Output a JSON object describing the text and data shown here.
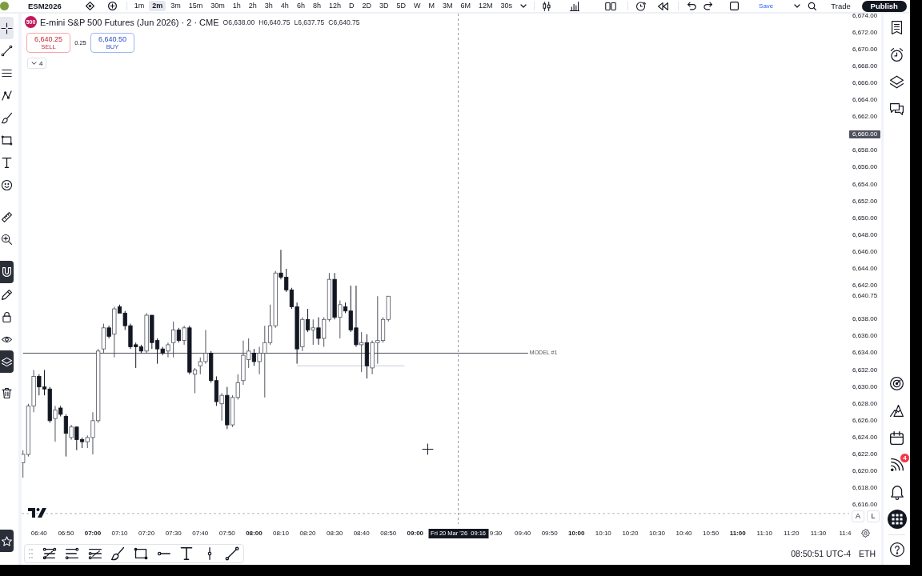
{
  "top_bar": {
    "symbol": "ESM2026",
    "timeframes": [
      {
        "label": "1m",
        "selected": false
      },
      {
        "label": "2m",
        "selected": true
      },
      {
        "label": "3m",
        "selected": false
      },
      {
        "label": "15m",
        "selected": false
      },
      {
        "label": "30m",
        "selected": false
      },
      {
        "label": "1h",
        "selected": false
      },
      {
        "label": "2h",
        "selected": false
      },
      {
        "label": "3h",
        "selected": false
      },
      {
        "label": "4h",
        "selected": false
      },
      {
        "label": "6h",
        "selected": false
      },
      {
        "label": "8h",
        "selected": false
      },
      {
        "label": "12h",
        "selected": false
      },
      {
        "label": "D",
        "selected": false
      },
      {
        "label": "2D",
        "selected": false
      },
      {
        "label": "3D",
        "selected": false
      },
      {
        "label": "5D",
        "selected": false
      },
      {
        "label": "W",
        "selected": false
      },
      {
        "label": "M",
        "selected": false
      },
      {
        "label": "3M",
        "selected": false
      },
      {
        "label": "6M",
        "selected": false
      },
      {
        "label": "12M",
        "selected": false
      },
      {
        "label": "30s",
        "selected": false
      }
    ],
    "save": "Save",
    "trade": "Trade",
    "publish": "Publish"
  },
  "left_toolbar": {
    "tools": [
      {
        "selected": true
      },
      {
        "selected": false
      },
      {
        "selected": false
      },
      {
        "selected": false
      },
      {
        "selected": false
      },
      {
        "selected": false
      },
      {
        "selected": false
      },
      {
        "selected": false
      },
      {
        "selected": false
      },
      {
        "selected": false
      }
    ],
    "toggles": [
      {
        "on": true
      },
      {
        "on": false
      },
      {
        "on": false
      },
      {
        "on": false
      },
      {
        "on": true
      }
    ],
    "favorites": {
      "on": true
    }
  },
  "chart": {
    "legend": {
      "logo_text": "500",
      "title": "E-mini S&P 500 Futures (Jun 2026) · 2 · CME",
      "ohlc": [
        "O6,638.00",
        "H6,640.75",
        "L6,637.75",
        "C6,640.75"
      ]
    },
    "sell": {
      "price": "6,640.25",
      "label": "SELL"
    },
    "spread": "0.25",
    "buy": {
      "price": "6,640.50",
      "label": "BUY"
    },
    "indicators_count": "4",
    "scale_buttons": [
      "A",
      "L"
    ],
    "chart_data": [
      {
        "type": "candlestick",
        "xlim": [
          "2026-03-20T06:33:30",
          "2026-03-20T11:41:30"
        ],
        "ylim": [
          6613.75,
          6674.25
        ],
        "x": [
          "2026-03-20T06:34",
          "2026-03-20T06:36",
          "2026-03-20T06:38",
          "2026-03-20T06:40",
          "2026-03-20T06:42",
          "2026-03-20T06:44",
          "2026-03-20T06:46",
          "2026-03-20T06:48",
          "2026-03-20T06:50",
          "2026-03-20T06:52",
          "2026-03-20T06:54",
          "2026-03-20T06:56",
          "2026-03-20T06:58",
          "2026-03-20T07:00",
          "2026-03-20T07:02",
          "2026-03-20T07:04",
          "2026-03-20T07:06",
          "2026-03-20T07:08",
          "2026-03-20T07:10",
          "2026-03-20T07:12",
          "2026-03-20T07:14",
          "2026-03-20T07:16",
          "2026-03-20T07:18",
          "2026-03-20T07:20",
          "2026-03-20T07:22",
          "2026-03-20T07:24",
          "2026-03-20T07:26",
          "2026-03-20T07:28",
          "2026-03-20T07:30",
          "2026-03-20T07:32",
          "2026-03-20T07:34",
          "2026-03-20T07:36",
          "2026-03-20T07:38",
          "2026-03-20T07:40",
          "2026-03-20T07:42",
          "2026-03-20T07:44",
          "2026-03-20T07:46",
          "2026-03-20T07:48",
          "2026-03-20T07:50",
          "2026-03-20T07:52",
          "2026-03-20T07:54",
          "2026-03-20T07:56",
          "2026-03-20T07:58",
          "2026-03-20T08:00",
          "2026-03-20T08:02",
          "2026-03-20T08:04",
          "2026-03-20T08:06",
          "2026-03-20T08:08",
          "2026-03-20T08:10",
          "2026-03-20T08:12",
          "2026-03-20T08:14",
          "2026-03-20T08:16",
          "2026-03-20T08:18",
          "2026-03-20T08:20",
          "2026-03-20T08:22",
          "2026-03-20T08:24",
          "2026-03-20T08:26",
          "2026-03-20T08:28",
          "2026-03-20T08:30",
          "2026-03-20T08:32",
          "2026-03-20T08:34",
          "2026-03-20T08:36",
          "2026-03-20T08:38",
          "2026-03-20T08:40",
          "2026-03-20T08:42",
          "2026-03-20T08:44",
          "2026-03-20T08:46",
          "2026-03-20T08:48",
          "2026-03-20T08:50"
        ],
        "ohlc": [
          [
            6621.0,
            6622.5,
            6619.25,
            6622.0
          ],
          [
            6622.0,
            6628.0,
            6621.75,
            6627.75
          ],
          [
            6627.75,
            6632.0,
            6627.0,
            6631.25
          ],
          [
            6631.25,
            6631.5,
            6629.0,
            6630.0
          ],
          [
            6630.0,
            6632.0,
            6629.0,
            6629.75
          ],
          [
            6629.75,
            6630.0,
            6625.75,
            6626.0
          ],
          [
            6626.25,
            6627.75,
            6623.5,
            6627.25
          ],
          [
            6627.5,
            6627.75,
            6626.5,
            6626.75
          ],
          [
            6626.5,
            6626.75,
            6621.75,
            6624.5
          ],
          [
            6624.0,
            6625.5,
            6623.75,
            6625.25
          ],
          [
            6625.25,
            6625.25,
            6622.5,
            6623.75
          ],
          [
            6623.75,
            6624.0,
            6622.75,
            6623.5
          ],
          [
            6623.5,
            6624.25,
            6622.75,
            6624.0
          ],
          [
            6624.0,
            6627.0,
            6622.0,
            6626.0
          ],
          [
            6626.0,
            6634.5,
            6625.75,
            6634.25
          ],
          [
            6634.5,
            6637.5,
            6634.0,
            6637.0
          ],
          [
            6637.0,
            6637.25,
            6635.75,
            6636.0
          ],
          [
            6636.25,
            6639.5,
            6633.5,
            6639.25
          ],
          [
            6639.5,
            6639.75,
            6638.75,
            6638.75
          ],
          [
            6638.75,
            6639.0,
            6636.75,
            6637.25
          ],
          [
            6637.25,
            6637.5,
            6634.5,
            6634.75
          ],
          [
            6635.0,
            6635.25,
            6632.25,
            6634.75
          ],
          [
            6634.75,
            6635.0,
            6634.0,
            6634.25
          ],
          [
            6634.25,
            6638.75,
            6634.0,
            6638.5
          ],
          [
            6638.5,
            6638.5,
            6634.5,
            6635.25
          ],
          [
            6635.5,
            6635.75,
            6632.75,
            6634.5
          ],
          [
            6634.5,
            6634.75,
            6633.75,
            6634.0
          ],
          [
            6634.25,
            6635.25,
            6633.5,
            6635.0
          ],
          [
            6635.25,
            6637.75,
            6633.5,
            6636.75
          ],
          [
            6636.75,
            6637.0,
            6635.25,
            6635.5
          ],
          [
            6635.5,
            6637.25,
            6635.0,
            6637.0
          ],
          [
            6637.0,
            6637.25,
            6631.5,
            6631.75
          ],
          [
            6631.5,
            6632.25,
            6629.25,
            6632.0
          ],
          [
            6632.5,
            6633.5,
            6631.5,
            6633.0
          ],
          [
            6633.0,
            6636.75,
            6632.75,
            6634.0
          ],
          [
            6634.0,
            6634.25,
            6630.5,
            6630.75
          ],
          [
            6630.75,
            6631.25,
            6627.75,
            6628.25
          ],
          [
            6628.0,
            6629.25,
            6626.0,
            6629.0
          ],
          [
            6629.0,
            6630.0,
            6625.0,
            6625.5
          ],
          [
            6625.5,
            6629.0,
            6625.25,
            6628.75
          ],
          [
            6628.75,
            6631.5,
            6628.5,
            6630.5
          ],
          [
            6630.75,
            6635.5,
            6630.25,
            6633.75
          ],
          [
            6633.25,
            6635.75,
            6632.25,
            6634.25
          ],
          [
            6634.0,
            6634.5,
            6632.5,
            6633.0
          ],
          [
            6633.0,
            6634.75,
            6631.5,
            6634.0
          ],
          [
            6634.0,
            6637.25,
            6628.75,
            6635.25
          ],
          [
            6635.25,
            6639.75,
            6635.0,
            6637.25
          ],
          [
            6637.25,
            6643.75,
            6637.0,
            6643.5
          ],
          [
            6643.5,
            6646.25,
            6642.75,
            6643.0
          ],
          [
            6643.0,
            6644.0,
            6641.25,
            6641.5
          ],
          [
            6641.5,
            6641.75,
            6639.25,
            6639.5
          ],
          [
            6639.5,
            6640.0,
            6632.75,
            6634.5
          ],
          [
            6634.75,
            6638.25,
            6634.25,
            6638.0
          ],
          [
            6638.0,
            6639.25,
            6636.5,
            6636.75
          ],
          [
            6636.75,
            6638.0,
            6635.0,
            6637.0
          ],
          [
            6637.0,
            6638.25,
            6635.0,
            6635.75
          ],
          [
            6635.75,
            6638.25,
            6634.75,
            6638.0
          ],
          [
            6638.0,
            6643.5,
            6637.75,
            6642.75
          ],
          [
            6642.75,
            6643.5,
            6638.0,
            6638.25
          ],
          [
            6638.25,
            6640.25,
            6635.75,
            6639.75
          ],
          [
            6639.5,
            6640.0,
            6638.75,
            6639.0
          ],
          [
            6639.0,
            6642.0,
            6636.5,
            6636.75
          ],
          [
            6637.0,
            6642.0,
            6634.75,
            6635.0
          ],
          [
            6635.0,
            6636.5,
            6631.75,
            6635.25
          ],
          [
            6635.25,
            6636.25,
            6631.0,
            6632.5
          ],
          [
            6632.25,
            6635.5,
            6631.5,
            6635.25
          ],
          [
            6635.25,
            6640.75,
            6632.75,
            6635.5
          ],
          [
            6635.5,
            6638.25,
            6635.25,
            6638.0
          ],
          [
            6638.0,
            6640.75,
            6637.75,
            6640.75
          ]
        ],
        "series": [
          {
            "name": "MODEL #1",
            "type": "line",
            "x": [
              "2026-03-20T06:34",
              "2026-03-20T09:42"
            ],
            "values": [
              6634,
              6634
            ],
            "color": "#50535e"
          },
          {
            "type": "line",
            "x": [
              "2026-03-20T08:16",
              "2026-03-20T08:56"
            ],
            "values": [
              6632.5,
              6632.5
            ],
            "color": "#c9ccd4"
          }
        ],
        "xticks": [
          {
            "value": "2026-03-20T06:40",
            "label": "06:40"
          },
          {
            "value": "2026-03-20T06:50",
            "label": "06:50"
          },
          {
            "value": "2026-03-20T07:00",
            "label": "07:00"
          },
          {
            "value": "2026-03-20T07:10",
            "label": "07:10"
          },
          {
            "value": "2026-03-20T07:20",
            "label": "07:20"
          },
          {
            "value": "2026-03-20T07:30",
            "label": "07:30"
          },
          {
            "value": "2026-03-20T07:40",
            "label": "07:40"
          },
          {
            "value": "2026-03-20T07:50",
            "label": "07:50"
          },
          {
            "value": "2026-03-20T08:00",
            "label": "08:00"
          },
          {
            "value": "2026-03-20T08:10",
            "label": "08:10"
          },
          {
            "value": "2026-03-20T08:20",
            "label": "08:20"
          },
          {
            "value": "2026-03-20T08:30",
            "label": "08:30"
          },
          {
            "value": "2026-03-20T08:40",
            "label": "08:40"
          },
          {
            "value": "2026-03-20T08:50",
            "label": "08:50"
          },
          {
            "value": "2026-03-20T09:00",
            "label": "09:00"
          },
          {
            "value": "2026-03-20T09:30",
            "label": "9:30"
          },
          {
            "value": "2026-03-20T09:40",
            "label": "09:40"
          },
          {
            "value": "2026-03-20T09:50",
            "label": "09:50"
          },
          {
            "value": "2026-03-20T10:00",
            "label": "10:00"
          },
          {
            "value": "2026-03-20T10:10",
            "label": "10:10"
          },
          {
            "value": "2026-03-20T10:20",
            "label": "10:20"
          },
          {
            "value": "2026-03-20T10:30",
            "label": "10:30"
          },
          {
            "value": "2026-03-20T10:40",
            "label": "10:40"
          },
          {
            "value": "2026-03-20T10:50",
            "label": "10:50"
          },
          {
            "value": "2026-03-20T11:00",
            "label": "11:00"
          },
          {
            "value": "2026-03-20T11:10",
            "label": "11:10"
          },
          {
            "value": "2026-03-20T11:20",
            "label": "11:20"
          },
          {
            "value": "2026-03-20T11:30",
            "label": "11:30"
          },
          {
            "value": "2026-03-20T11:40",
            "label": "11:4"
          }
        ],
        "yticks": [
          {
            "value": 6674,
            "label": "6,674.00"
          },
          {
            "value": 6672,
            "label": "6,672.00"
          },
          {
            "value": 6670,
            "label": "6,670.00"
          },
          {
            "value": 6668,
            "label": "6,668.00"
          },
          {
            "value": 6666,
            "label": "6,666.00"
          },
          {
            "value": 6664,
            "label": "6,664.00"
          },
          {
            "value": 6662,
            "label": "6,662.00"
          },
          {
            "value": 6658,
            "label": "6,658.00"
          },
          {
            "value": 6656,
            "label": "6,656.00"
          },
          {
            "value": 6654,
            "label": "6,654.00"
          },
          {
            "value": 6652,
            "label": "6,652.00"
          },
          {
            "value": 6650,
            "label": "6,650.00"
          },
          {
            "value": 6648,
            "label": "6,648.00"
          },
          {
            "value": 6646,
            "label": "6,646.00"
          },
          {
            "value": 6644,
            "label": "6,644.00"
          },
          {
            "value": 6642,
            "label": "6,642.00"
          },
          {
            "value": 6640.75,
            "label": "6,640.75"
          },
          {
            "value": 6638,
            "label": "6,638.00"
          },
          {
            "value": 6636,
            "label": "6,636.00"
          },
          {
            "value": 6634,
            "label": "6,634.00"
          },
          {
            "value": 6632,
            "label": "6,632.00"
          },
          {
            "value": 6630,
            "label": "6,630.00"
          },
          {
            "value": 6628,
            "label": "6,628.00"
          },
          {
            "value": 6626,
            "label": "6,626.00"
          },
          {
            "value": 6624,
            "label": "6,624.00"
          },
          {
            "value": 6622,
            "label": "6,622.00"
          },
          {
            "value": 6620,
            "label": "6,620.00"
          },
          {
            "value": 6618,
            "label": "6,618.00"
          },
          {
            "value": 6616,
            "label": "6,616.00"
          }
        ],
        "ref_lines": [
          {
            "axis": "x",
            "value": "2026-03-20T09:16",
            "label": "Fri 20 Mar '26  09:16",
            "color": "#9598a1",
            "line_style": "dashed"
          },
          {
            "axis": "y",
            "value": 6615,
            "color": "#b2b5be",
            "line_style": "dashed"
          }
        ],
        "annotations": [
          "6,660.00"
        ]
      }
    ]
  },
  "status": {
    "time": "08:50:51 UTC-4",
    "session": "ETH"
  },
  "right_sidebar": {
    "alert_count": "4"
  }
}
